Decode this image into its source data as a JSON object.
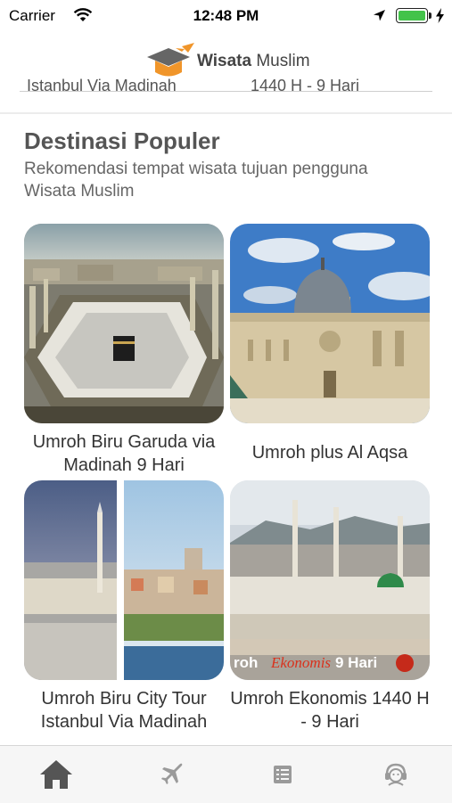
{
  "status_bar": {
    "carrier": "Carrier",
    "time": "12:48 PM",
    "battery_level": 1.0,
    "icons": [
      "wifi-icon",
      "location-arrow-icon",
      "battery-icon",
      "charging-bolt-icon"
    ]
  },
  "header": {
    "logo_icon": "graduation-cap-plane-icon",
    "logo_bold": "Wisata",
    "logo_regular": "Muslim"
  },
  "previous_section": {
    "left_cut_text": "Istanbul Via Madinah",
    "right_cut_text": "1440 H - 9 Hari"
  },
  "popular": {
    "title": "Destinasi Populer",
    "subtitle": "Rekomendasi tempat wisata tujuan pengguna Wisata Muslim",
    "cards": [
      {
        "label": "Umroh Biru Garuda via Madinah 9 Hari",
        "image": "kaaba-mecca-photo"
      },
      {
        "label": "Umroh plus Al Aqsa",
        "image": "al-aqsa-dome-photo"
      },
      {
        "label": "Umroh Biru City Tour Istanbul Via Madinah",
        "image": "madinah-istanbul-photo"
      },
      {
        "label": "Umroh Ekonomis 1440 H - 9 Hari",
        "image": "nabawi-mosque-photo",
        "banner_left": "roh",
        "banner_mid": "Ekonomis",
        "banner_right": "9 Hari"
      }
    ]
  },
  "colors": {
    "accent_orange": "#f0952a",
    "logo_gray": "#555555",
    "tab_active": "#555555",
    "tab_inactive": "#9a9a9a"
  },
  "tabbar": [
    {
      "icon": "home-icon",
      "active": true
    },
    {
      "icon": "airplane-icon",
      "active": false
    },
    {
      "icon": "list-icon",
      "active": false
    },
    {
      "icon": "customer-service-icon",
      "active": false
    }
  ]
}
